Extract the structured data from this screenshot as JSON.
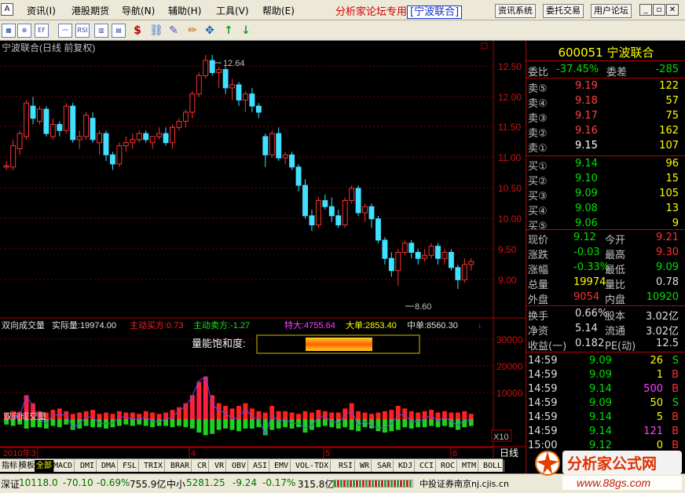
{
  "menubar": {
    "items": [
      "资讯(I)",
      "港股期货",
      "导航(N)",
      "辅助(H)",
      "工具(V)",
      "帮助(E)"
    ],
    "banner": "分析家论坛专用",
    "banner_stock": "[宁波联合]",
    "nav_buttons": [
      "资讯系统",
      "委托交易",
      "用户论坛"
    ]
  },
  "chart": {
    "title": "宁波联合(日线 前复权)",
    "high_marker": "12.64",
    "low_marker": "8.60",
    "price_axis": [
      "12.50",
      "12.00",
      "11.50",
      "11.00",
      "10.50",
      "10.00",
      "9.50",
      "9.00"
    ],
    "volume_axis": [
      "30000",
      "20000",
      "10000"
    ],
    "x10_label": "X10",
    "x_labels": [
      "2010年3",
      "4",
      "5",
      "6"
    ],
    "day_label": "日线"
  },
  "indicator": {
    "name": "双向成交量",
    "actual_label": "实际量:19974.00",
    "active_buy": "主动买方:0.73",
    "active_sell": "主动卖方:-1.27",
    "super_large": "特大:4755.64",
    "large": "大单:2853.40",
    "medium": "中单:8560.30",
    "saturation_label": "量能饱和度:",
    "overlay_text": "双向成交量"
  },
  "tabs": [
    "指标",
    "模板",
    "全部",
    "MACD",
    "DMI",
    "DMA",
    "FSL",
    "TRIX",
    "BRAR",
    "CR",
    "VR",
    "OBV",
    "ASI",
    "EMV",
    "VOL-TDX",
    "RSI",
    "WR",
    "SAR",
    "KDJ",
    "CCI",
    "ROC",
    "MTM",
    "BOLL"
  ],
  "active_tab": "全部",
  "statusbar": {
    "sz_label": "深证",
    "sz_value": "10118.0",
    "sz_change": "-70.10",
    "sz_pct": "-0.69%",
    "sz_amount": "755.9亿",
    "zx_label": "中小",
    "zx_value": "5281.25",
    "zx_change": "-9.24",
    "zx_pct": "-0.17%",
    "zx_amount": "315.8亿",
    "broker": "中投证券南京nj.cjis.cn"
  },
  "quote": {
    "code": "600051",
    "name": "宁波联合",
    "webi_label": "委比",
    "webi": "-37.45%",
    "weicha_label": "委差",
    "weicha": "-285",
    "asks": [
      {
        "label": "卖⑤",
        "price": "9.19",
        "vol": "122"
      },
      {
        "label": "卖④",
        "price": "9.18",
        "vol": "57"
      },
      {
        "label": "卖③",
        "price": "9.17",
        "vol": "75"
      },
      {
        "label": "卖②",
        "price": "9.16",
        "vol": "162"
      },
      {
        "label": "卖①",
        "price": "9.15",
        "vol": "107"
      }
    ],
    "bids": [
      {
        "label": "买①",
        "price": "9.14",
        "vol": "96"
      },
      {
        "label": "买②",
        "price": "9.10",
        "vol": "15"
      },
      {
        "label": "买③",
        "price": "9.09",
        "vol": "105"
      },
      {
        "label": "买④",
        "price": "9.08",
        "vol": "13"
      },
      {
        "label": "买⑤",
        "price": "9.06",
        "vol": "9"
      }
    ],
    "stats": [
      {
        "l1": "现价",
        "v1": "9.12",
        "l2": "今开",
        "v2": "9.21"
      },
      {
        "l1": "涨跌",
        "v1": "-0.03",
        "l2": "最高",
        "v2": "9.30"
      },
      {
        "l1": "涨幅",
        "v1": "-0.33%",
        "l2": "最低",
        "v2": "9.09"
      },
      {
        "l1": "总量",
        "v1": "19974",
        "l2": "量比",
        "v2": "0.78"
      },
      {
        "l1": "外盘",
        "v1": "9054",
        "l2": "内盘",
        "v2": "10920"
      }
    ],
    "stats2": [
      {
        "l1": "换手",
        "v1": "0.66%",
        "l2": "股本",
        "v2": "3.02亿"
      },
      {
        "l1": "净资",
        "v1": "5.14",
        "l2": "流通",
        "v2": "3.02亿"
      },
      {
        "l1": "收益(一)",
        "v1": "0.182",
        "l2": "PE(动)",
        "v2": "12.5"
      }
    ],
    "ticks": [
      {
        "t": "14:59",
        "p": "9.09",
        "v": "26",
        "d": "S"
      },
      {
        "t": "14:59",
        "p": "9.09",
        "v": "1",
        "d": "B"
      },
      {
        "t": "14:59",
        "p": "9.14",
        "v": "500",
        "d": "B"
      },
      {
        "t": "14:59",
        "p": "9.09",
        "v": "50",
        "d": "S"
      },
      {
        "t": "14:59",
        "p": "9.14",
        "v": "5",
        "d": "B"
      },
      {
        "t": "14:59",
        "p": "9.14",
        "v": "121",
        "d": "B"
      },
      {
        "t": "15:00",
        "p": "9.12",
        "v": "0",
        "d": "B"
      }
    ]
  },
  "logo": {
    "text": "分析家公式网",
    "url": "www.88gs.com"
  },
  "chart_data": {
    "type": "candlestick",
    "title": "宁波联合(日线 前复权)",
    "ylim": [
      8.5,
      12.7
    ],
    "candles": [
      [
        10.8,
        10.9,
        10.75,
        10.82
      ],
      [
        10.8,
        11.25,
        10.75,
        11.15
      ],
      [
        11.1,
        11.4,
        11.0,
        11.35
      ],
      [
        11.3,
        11.9,
        11.25,
        11.85
      ],
      [
        11.8,
        11.95,
        11.5,
        11.6
      ],
      [
        11.55,
        11.8,
        11.5,
        11.75
      ],
      [
        11.75,
        11.8,
        11.3,
        11.35
      ],
      [
        11.3,
        11.6,
        11.25,
        11.5
      ],
      [
        11.5,
        11.55,
        11.3,
        11.4
      ],
      [
        11.4,
        11.85,
        11.35,
        11.8
      ],
      [
        11.8,
        11.85,
        11.2,
        11.25
      ],
      [
        11.25,
        11.4,
        11.1,
        11.3
      ],
      [
        11.3,
        11.7,
        11.25,
        11.65
      ],
      [
        11.6,
        11.7,
        11.2,
        11.25
      ],
      [
        11.2,
        11.4,
        11.0,
        11.35
      ],
      [
        11.35,
        11.4,
        10.9,
        11.0
      ],
      [
        11.0,
        11.05,
        10.75,
        10.85
      ],
      [
        10.85,
        11.2,
        10.8,
        11.15
      ],
      [
        11.15,
        11.3,
        11.05,
        11.2
      ],
      [
        11.2,
        11.35,
        11.1,
        11.25
      ],
      [
        11.25,
        11.4,
        11.2,
        11.35
      ],
      [
        11.35,
        11.4,
        11.2,
        11.25
      ],
      [
        11.2,
        11.3,
        11.1,
        11.3
      ],
      [
        11.3,
        11.45,
        11.25,
        11.35
      ],
      [
        11.35,
        11.45,
        11.15,
        11.2
      ],
      [
        11.2,
        11.5,
        11.1,
        11.45
      ],
      [
        11.45,
        11.6,
        11.4,
        11.55
      ],
      [
        11.55,
        11.75,
        11.45,
        11.7
      ],
      [
        11.7,
        12.05,
        11.6,
        12.0
      ],
      [
        12.0,
        12.35,
        11.95,
        12.3
      ],
      [
        12.3,
        12.64,
        12.25,
        12.55
      ],
      [
        12.55,
        12.64,
        12.3,
        12.35
      ],
      [
        12.35,
        12.45,
        12.1,
        12.4
      ],
      [
        12.4,
        12.45,
        12.0,
        12.1
      ],
      [
        12.1,
        12.25,
        11.9,
        12.15
      ],
      [
        12.15,
        12.2,
        11.8,
        11.9
      ],
      [
        11.9,
        12.05,
        11.7,
        12.0
      ],
      [
        12.0,
        12.1,
        11.7,
        11.8
      ],
      [
        11.8,
        11.85,
        11.6,
        11.7
      ],
      [
        11.3,
        11.35,
        10.8,
        11.0
      ],
      [
        11.0,
        11.4,
        10.95,
        11.35
      ],
      [
        11.35,
        11.45,
        10.9,
        10.95
      ],
      [
        10.95,
        11.05,
        10.85,
        11.0
      ],
      [
        11.0,
        11.05,
        10.75,
        10.8
      ],
      [
        10.8,
        10.85,
        10.4,
        10.5
      ],
      [
        10.5,
        10.6,
        9.95,
        10.0
      ],
      [
        10.0,
        10.1,
        9.75,
        9.85
      ],
      [
        9.85,
        10.3,
        9.8,
        10.25
      ],
      [
        10.25,
        10.35,
        10.1,
        10.15
      ],
      [
        10.15,
        10.3,
        9.9,
        10.0
      ],
      [
        10.0,
        10.1,
        9.8,
        9.85
      ],
      [
        9.85,
        10.3,
        9.8,
        10.25
      ],
      [
        10.25,
        10.5,
        10.2,
        10.45
      ],
      [
        10.45,
        10.5,
        10.0,
        10.05
      ],
      [
        10.05,
        10.2,
        9.9,
        10.15
      ],
      [
        10.15,
        10.2,
        9.8,
        9.95
      ],
      [
        9.95,
        10.0,
        9.55,
        9.6
      ],
      [
        9.6,
        9.65,
        9.2,
        9.3
      ],
      [
        9.3,
        9.4,
        9.0,
        9.1
      ],
      [
        9.1,
        9.45,
        8.85,
        9.4
      ],
      [
        9.4,
        9.6,
        9.35,
        9.55
      ],
      [
        9.55,
        9.6,
        9.3,
        9.4
      ],
      [
        9.4,
        9.45,
        9.2,
        9.3
      ],
      [
        9.3,
        9.45,
        9.25,
        9.35
      ],
      [
        9.35,
        9.55,
        9.3,
        9.5
      ],
      [
        9.5,
        9.55,
        9.2,
        9.3
      ],
      [
        9.3,
        9.45,
        9.2,
        9.4
      ],
      [
        9.4,
        9.45,
        9.1,
        9.15
      ],
      [
        9.15,
        9.2,
        8.8,
        8.95
      ],
      [
        8.95,
        9.3,
        8.9,
        9.2
      ],
      [
        9.2,
        9.3,
        9.1,
        9.25
      ]
    ],
    "volume_up": [
      2500,
      3000,
      2800,
      9000,
      6000,
      3000,
      2500,
      3500,
      4000,
      3000,
      2000,
      2500,
      3000,
      3500,
      2000,
      2500,
      2000,
      3000,
      2500,
      2500,
      2000,
      3000,
      2500,
      2000,
      2500,
      3500,
      4500,
      6000,
      9000,
      14000,
      16000,
      9000,
      6000,
      5000,
      4000,
      5000,
      6000,
      4000,
      3000,
      2500,
      5000,
      3000,
      3000,
      2500,
      2000,
      3000,
      2500,
      3500,
      3000,
      2500,
      2500,
      4000,
      6000,
      3000,
      2500,
      2000,
      2500,
      3000,
      3500,
      5000,
      4000,
      3000,
      2500,
      3000,
      3500,
      2500,
      3000,
      2500,
      2500,
      3000,
      2000
    ],
    "volume_down": [
      2000,
      2500,
      2000,
      3500,
      3000,
      3000,
      3500,
      2500,
      3000,
      2000,
      4000,
      3500,
      2500,
      3000,
      3000,
      3500,
      3000,
      2500,
      2000,
      2500,
      2000,
      2500,
      3000,
      2500,
      2500,
      3000,
      2500,
      3000,
      3500,
      5000,
      6000,
      5500,
      4000,
      3500,
      4000,
      4500,
      3500,
      3500,
      3000,
      6000,
      4000,
      3500,
      3000,
      3500,
      3000,
      5000,
      4000,
      3000,
      2500,
      3000,
      3500,
      3000,
      4000,
      4500,
      3000,
      3500,
      4500,
      5000,
      4500,
      4000,
      3000,
      3500,
      3000,
      3000,
      2500,
      3000,
      2500,
      3000,
      4000,
      3000,
      2500
    ]
  }
}
